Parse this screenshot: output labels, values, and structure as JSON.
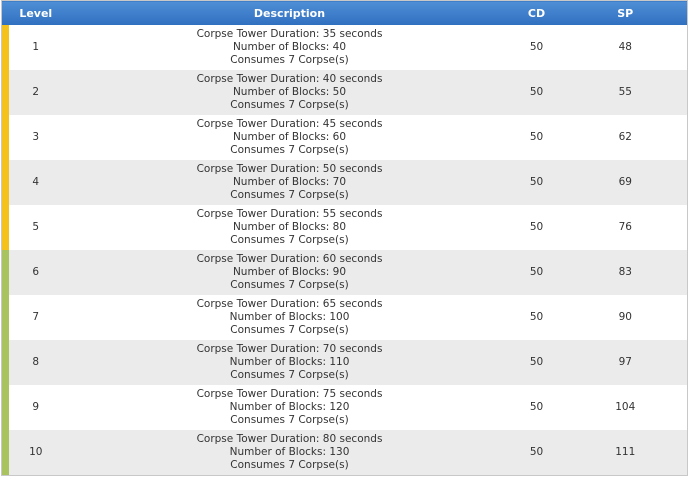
{
  "table": {
    "headers": {
      "level": "Level",
      "description": "Description",
      "cd": "CD",
      "sp": "SP"
    },
    "colors": {
      "tier1": "#f5c21b",
      "tier2": "#a9c45e",
      "header": "#3a7bd0"
    },
    "rows": [
      {
        "level": "1",
        "tier": "tier1",
        "desc": [
          "Corpse Tower Duration: 35 seconds",
          "Number of Blocks: 40",
          "Consumes 7 Corpse(s)"
        ],
        "cd": "50",
        "sp": "48"
      },
      {
        "level": "2",
        "tier": "tier1",
        "desc": [
          "Corpse Tower Duration: 40 seconds",
          "Number of Blocks: 50",
          "Consumes 7 Corpse(s)"
        ],
        "cd": "50",
        "sp": "55"
      },
      {
        "level": "3",
        "tier": "tier1",
        "desc": [
          "Corpse Tower Duration: 45 seconds",
          "Number of Blocks: 60",
          "Consumes 7 Corpse(s)"
        ],
        "cd": "50",
        "sp": "62"
      },
      {
        "level": "4",
        "tier": "tier1",
        "desc": [
          "Corpse Tower Duration: 50 seconds",
          "Number of Blocks: 70",
          "Consumes 7 Corpse(s)"
        ],
        "cd": "50",
        "sp": "69"
      },
      {
        "level": "5",
        "tier": "tier1",
        "desc": [
          "Corpse Tower Duration: 55 seconds",
          "Number of Blocks: 80",
          "Consumes 7 Corpse(s)"
        ],
        "cd": "50",
        "sp": "76"
      },
      {
        "level": "6",
        "tier": "tier2",
        "desc": [
          "Corpse Tower Duration: 60 seconds",
          "Number of Blocks: 90",
          "Consumes 7 Corpse(s)"
        ],
        "cd": "50",
        "sp": "83"
      },
      {
        "level": "7",
        "tier": "tier2",
        "desc": [
          "Corpse Tower Duration: 65 seconds",
          "Number of Blocks: 100",
          "Consumes 7 Corpse(s)"
        ],
        "cd": "50",
        "sp": "90"
      },
      {
        "level": "8",
        "tier": "tier2",
        "desc": [
          "Corpse Tower Duration: 70 seconds",
          "Number of Blocks: 110",
          "Consumes 7 Corpse(s)"
        ],
        "cd": "50",
        "sp": "97"
      },
      {
        "level": "9",
        "tier": "tier2",
        "desc": [
          "Corpse Tower Duration: 75 seconds",
          "Number of Blocks: 120",
          "Consumes 7 Corpse(s)"
        ],
        "cd": "50",
        "sp": "104"
      },
      {
        "level": "10",
        "tier": "tier2",
        "desc": [
          "Corpse Tower Duration: 80 seconds",
          "Number of Blocks: 130",
          "Consumes 7 Corpse(s)"
        ],
        "cd": "50",
        "sp": "111"
      }
    ]
  }
}
